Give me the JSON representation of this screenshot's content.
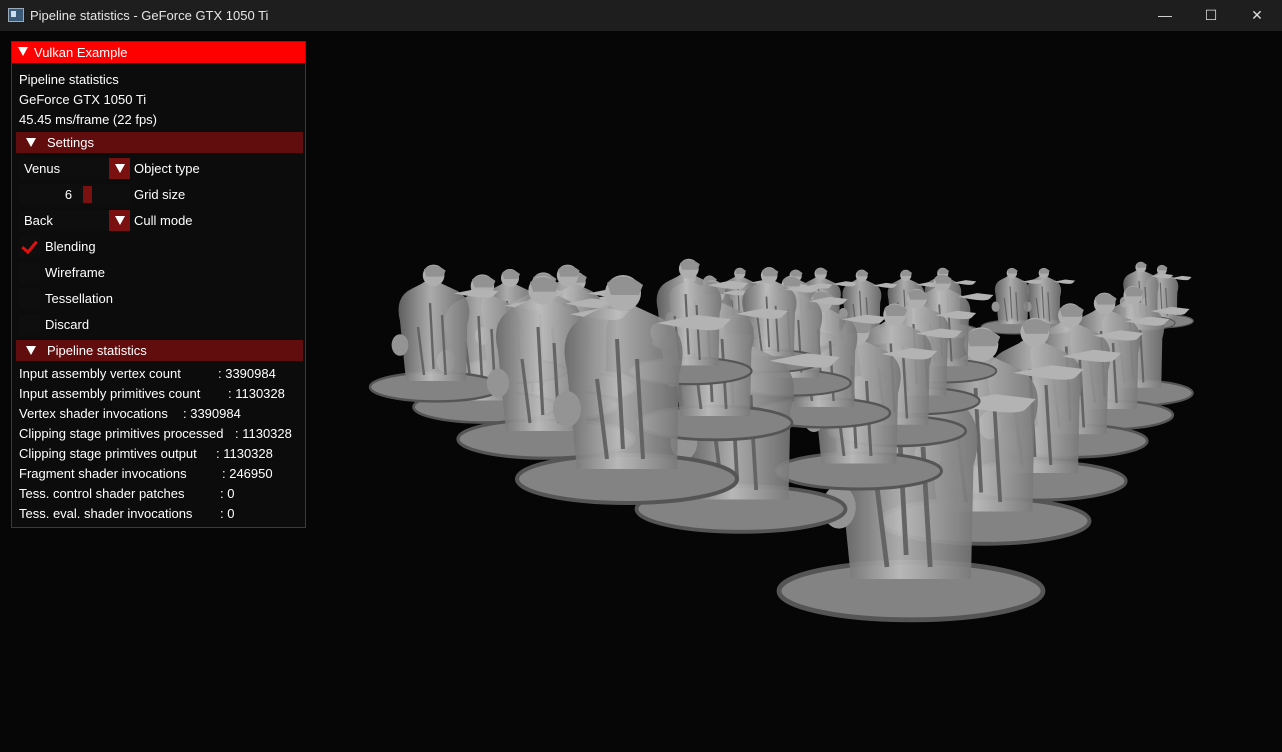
{
  "window": {
    "title": "Pipeline statistics - GeForce GTX 1050 Ti",
    "controls": {
      "minimize": "—",
      "maximize": "☐",
      "close": "✕"
    }
  },
  "panel": {
    "title": "Vulkan Example",
    "app_name": "Pipeline statistics",
    "device": "GeForce GTX 1050 Ti",
    "frame_time": "45.45 ms/frame (22 fps)",
    "settings": {
      "header": "Settings",
      "object_type": {
        "value": "Venus",
        "label": "Object type"
      },
      "grid_size": {
        "value": "6",
        "label": "Grid size"
      },
      "cull_mode": {
        "value": "Back",
        "label": "Cull mode"
      },
      "checkboxes": [
        {
          "label": "Blending",
          "checked": true
        },
        {
          "label": "Wireframe",
          "checked": false
        },
        {
          "label": "Tessellation",
          "checked": false
        },
        {
          "label": "Discard",
          "checked": false
        }
      ]
    },
    "stats": {
      "header": "Pipeline statistics",
      "rows": [
        {
          "label": "Input assembly vertex count",
          "value": ": 3390984"
        },
        {
          "label": "Input assembly primitives count",
          "value": ": 1130328"
        },
        {
          "label": "Vertex shader invocations",
          "value": ": 3390984"
        },
        {
          "label": "Clipping stage primitives processed",
          "value": ": 1130328"
        },
        {
          "label": "Clipping stage primtives output",
          "value": ": 1130328"
        },
        {
          "label": "Fragment shader invocations",
          "value": ": 246950"
        },
        {
          "label": "Tess. control shader patches",
          "value": ": 0"
        },
        {
          "label": "Tess. eval. shader invocations",
          "value": ": 0"
        }
      ]
    }
  },
  "colors": {
    "header_accent": "#ff0000",
    "section_bg": "#620d0d",
    "control_accent": "#7a1010"
  }
}
